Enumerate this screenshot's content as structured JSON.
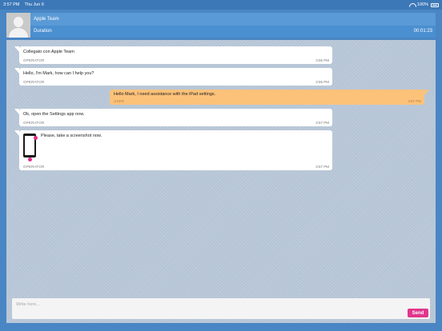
{
  "statusbar": {
    "time": "3:57 PM",
    "date": "Thu Jun 6",
    "battery": "100%",
    "wifi_icon": "wifi-icon",
    "battery_icon": "battery-icon"
  },
  "header": {
    "name": "Apple Team",
    "duration_label": "Duration",
    "duration_value": "00:01:23",
    "avatar_icon": "person-avatar-icon"
  },
  "messages": [
    {
      "text": "Collegato con Apple Team",
      "role": "OPERATOR",
      "time": "3:56 PM"
    },
    {
      "text": "Hello, I'm Mark, how can I help you?",
      "role": "OPERATOR",
      "time": "3:56 PM"
    },
    {
      "text": "Hello Mark, I need assistance with the iPad settings.",
      "role": "USER",
      "time": "3:57 PM"
    },
    {
      "text": "Ok, open the Settings app now.",
      "role": "OPERATOR",
      "time": "3:57 PM"
    },
    {
      "text": "Please, take a screenshot now.",
      "role": "OPERATOR",
      "time": "3:57 PM",
      "icon": "ipad-screenshot-icon"
    }
  ],
  "composer": {
    "placeholder": "Write here...",
    "value": "",
    "send_label": "Send"
  },
  "colors": {
    "accent": "#e0368d",
    "user_bubble": "#fdc27a",
    "operator_bubble": "#ffffff",
    "header": "#5a9ad6"
  }
}
